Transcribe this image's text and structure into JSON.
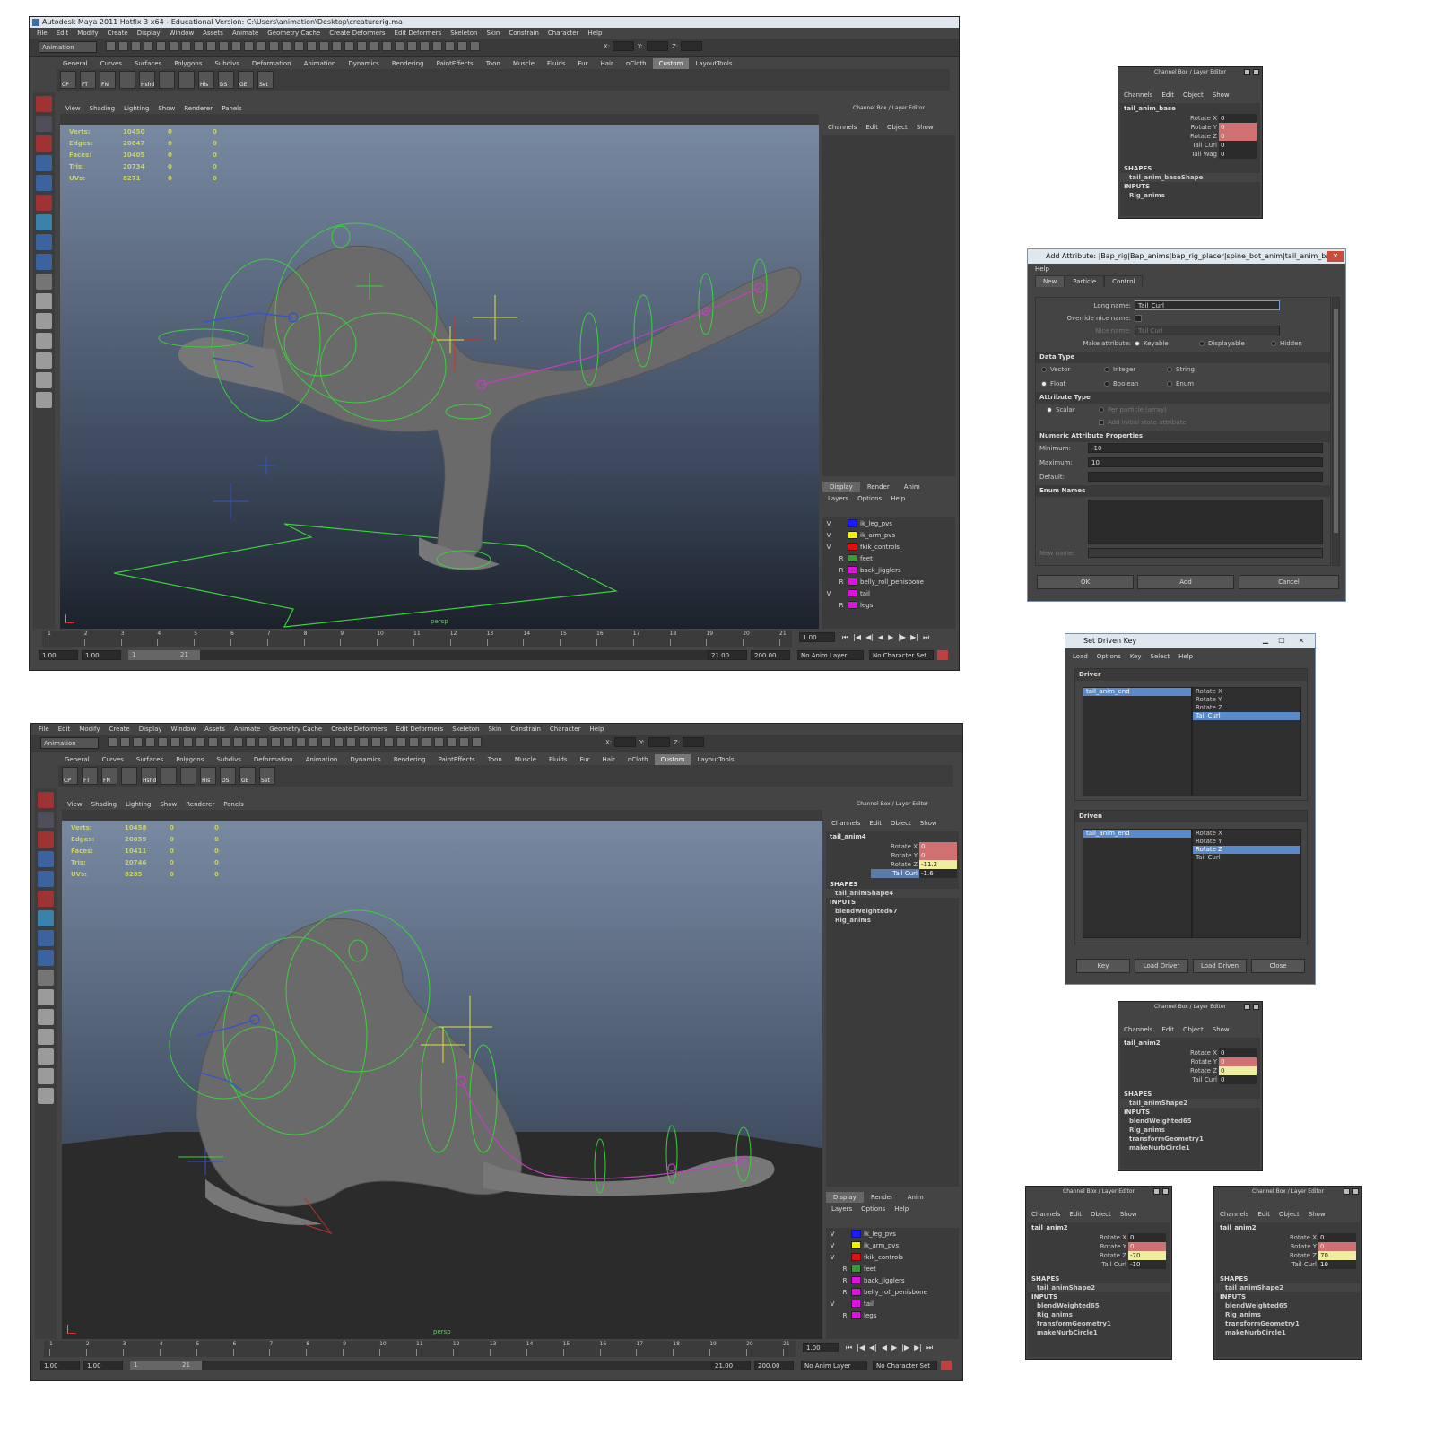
{
  "maya": {
    "title": "Autodesk Maya 2011 Hotfix 3 x64 - Educational Version: C:\\Users\\animation\\Desktop\\creaturerig.ma",
    "menus": [
      "File",
      "Edit",
      "Modify",
      "Create",
      "Display",
      "Window",
      "Assets",
      "Animate",
      "Geometry Cache",
      "Create Deformers",
      "Edit Deformers",
      "Skeleton",
      "Skin",
      "Constrain",
      "Character",
      "Help"
    ],
    "mode": "Animation",
    "field_labels": {
      "x": "X:",
      "y": "Y:",
      "z": "Z:"
    },
    "shelf_tabs": [
      "General",
      "Curves",
      "Surfaces",
      "Polygons",
      "Subdivs",
      "Deformation",
      "Animation",
      "Dynamics",
      "Rendering",
      "PaintEffects",
      "Toon",
      "Muscle",
      "Fluids",
      "Fur",
      "Hair",
      "nCloth",
      "Custom",
      "LayoutTools"
    ],
    "shelf_active": "Custom",
    "shelf_buttons": [
      "CP",
      "FT",
      "FN",
      "",
      "Hshd",
      "",
      "",
      "His",
      "DS",
      "GE",
      "Set"
    ],
    "panel_menus": [
      "View",
      "Shading",
      "Lighting",
      "Show",
      "Renderer",
      "Panels"
    ],
    "hud_labels": [
      "Verts:",
      "Edges:",
      "Faces:",
      "Tris:",
      "UVs:"
    ],
    "camera": "persp",
    "cb_header": "Channel Box / Layer Editor",
    "cb_menus": [
      "Channels",
      "Edit",
      "Object",
      "Show"
    ],
    "layer_tabs": [
      "Display",
      "Render",
      "Anim"
    ],
    "layer_menus": [
      "Layers",
      "Options",
      "Help"
    ],
    "layers": [
      {
        "vis": "V",
        "ref": "",
        "color": "#1a1aff",
        "name": "ik_leg_pvs"
      },
      {
        "vis": "V",
        "ref": "",
        "color": "#f0f000",
        "name": "ik_arm_pvs"
      },
      {
        "vis": "V",
        "ref": "",
        "color": "#e01010",
        "name": "fkik_controls"
      },
      {
        "vis": "",
        "ref": "R",
        "color": "#3a9a3a",
        "name": "feet"
      },
      {
        "vis": "",
        "ref": "R",
        "color": "#e010e0",
        "name": "back_jigglers"
      },
      {
        "vis": "",
        "ref": "R",
        "color": "#e010e0",
        "name": "belly_roll_penisbone"
      },
      {
        "vis": "V",
        "ref": "",
        "color": "#e010e0",
        "name": "tail"
      },
      {
        "vis": "",
        "ref": "R",
        "color": "#e010e0",
        "name": "legs"
      }
    ],
    "ticks": [
      "1",
      "2",
      "3",
      "4",
      "5",
      "6",
      "7",
      "8",
      "9",
      "10",
      "11",
      "12",
      "13",
      "14",
      "15",
      "16",
      "17",
      "18",
      "19",
      "20",
      "21"
    ],
    "current_frame": "1.00",
    "range": {
      "start": "1.00",
      "start2": "1.00",
      "inner_start": "1",
      "inner_end": "21",
      "end": "21.00",
      "end2": "200.00"
    },
    "anim_layer": "No Anim Layer",
    "char_set": "No Character Set",
    "top": {
      "hud": [
        [
          "10450",
          "0",
          "0"
        ],
        [
          "20847",
          "0",
          "0"
        ],
        [
          "10405",
          "0",
          "0"
        ],
        [
          "20734",
          "0",
          "0"
        ],
        [
          "8271",
          "0",
          "0"
        ]
      ]
    },
    "bottom": {
      "hud": [
        [
          "10458",
          "0",
          "0"
        ],
        [
          "20859",
          "0",
          "0"
        ],
        [
          "10411",
          "0",
          "0"
        ],
        [
          "20746",
          "0",
          "0"
        ],
        [
          "8285",
          "0",
          "0"
        ]
      ],
      "cb": {
        "object": "tail_anim4",
        "attrs": [
          {
            "name": "Rotate X",
            "value": "0",
            "style": "red"
          },
          {
            "name": "Rotate Y",
            "value": "0",
            "style": "red"
          },
          {
            "name": "Rotate Z",
            "value": "-11.2",
            "style": "yel"
          },
          {
            "name": "Tail Curl",
            "value": "-1.6",
            "style": "",
            "hl": true
          }
        ],
        "shapes_label": "SHAPES",
        "shape": "tail_animShape4",
        "inputs_label": "INPUTS",
        "inputs": [
          "blendWeighted67",
          "Rig_anims"
        ]
      }
    }
  },
  "cb_base": {
    "object": "tail_anim_base",
    "attrs": [
      {
        "name": "Rotate X",
        "value": "0",
        "style": ""
      },
      {
        "name": "Rotate Y",
        "value": "0",
        "style": "red"
      },
      {
        "name": "Rotate Z",
        "value": "0",
        "style": "red"
      },
      {
        "name": "Tail Curl",
        "value": "0",
        "style": ""
      },
      {
        "name": "Tail Wag",
        "value": "0",
        "style": ""
      }
    ],
    "shapes_label": "SHAPES",
    "shape": "tail_anim_baseShape",
    "inputs_label": "INPUTS",
    "inputs": [
      "Rig_anims"
    ]
  },
  "add_attr": {
    "title": "Add Attribute: |Bap_rig|Bap_anims|bap_rig_placer|spine_bot_anim|tail_anim_base",
    "menu": "Help",
    "tabs": [
      "New",
      "Particle",
      "Control"
    ],
    "long_name_label": "Long name:",
    "long_name": "Tail_Curl",
    "override_label": "Override nice name:",
    "nice_label": "Nice name:",
    "nice_name": "Tail Curl",
    "make_label": "Make attribute:",
    "make_opts": [
      "Keyable",
      "Displayable",
      "Hidden"
    ],
    "data_type_label": "Data Type",
    "data_types": [
      "Vector",
      "Integer",
      "String",
      "Float",
      "Boolean",
      "Enum"
    ],
    "attr_type_label": "Attribute Type",
    "scalar": "Scalar",
    "per_particle": "Per particle (array)",
    "add_initial": "Add initial state attribute",
    "numeric_label": "Numeric Attribute Properties",
    "min_label": "Minimum:",
    "min": "-10",
    "max_label": "Maximum:",
    "max": "10",
    "default_label": "Default:",
    "enum_label": "Enum Names",
    "new_name_label": "New name:",
    "buttons": [
      "OK",
      "Add",
      "Cancel"
    ]
  },
  "sdk": {
    "title": "Set Driven Key",
    "menus": [
      "Load",
      "Options",
      "Key",
      "Select",
      "Help"
    ],
    "driver_label": "Driver",
    "driver_obj": "tail_anim_end",
    "driver_attrs": [
      "Rotate X",
      "Rotate Y",
      "Rotate Z",
      "Tail Curl"
    ],
    "driven_label": "Driven",
    "driven_obj": "tail_anim_end",
    "driven_attrs": [
      "Rotate X",
      "Rotate Y",
      "Rotate Z",
      "Tail Curl"
    ],
    "buttons": [
      "Key",
      "Load Driver",
      "Load Driven",
      "Close"
    ]
  },
  "cb_a": {
    "object": "tail_anim2",
    "attrs": [
      {
        "name": "Rotate X",
        "value": "0",
        "style": ""
      },
      {
        "name": "Rotate Y",
        "value": "0",
        "style": "red"
      },
      {
        "name": "Rotate Z",
        "value": "0",
        "style": "yel"
      },
      {
        "name": "Tail Curl",
        "value": "0",
        "style": ""
      }
    ],
    "shapes_label": "SHAPES",
    "shape": "tail_animShape2",
    "inputs_label": "INPUTS",
    "inputs": [
      "blendWeighted65",
      "Rig_anims",
      "transformGeometry1",
      "makeNurbCircle1"
    ]
  },
  "cb_b": {
    "object": "tail_anim2",
    "attrs": [
      {
        "name": "Rotate X",
        "value": "0",
        "style": ""
      },
      {
        "name": "Rotate Y",
        "value": "0",
        "style": "red"
      },
      {
        "name": "Rotate Z",
        "value": "-70",
        "style": "yel"
      },
      {
        "name": "Tail Curl",
        "value": "-10",
        "style": ""
      }
    ],
    "shapes_label": "SHAPES",
    "shape": "tail_animShape2",
    "inputs_label": "INPUTS",
    "inputs": [
      "blendWeighted65",
      "Rig_anims",
      "transformGeometry1",
      "makeNurbCircle1"
    ]
  },
  "cb_c": {
    "object": "tail_anim2",
    "attrs": [
      {
        "name": "Rotate X",
        "value": "0",
        "style": ""
      },
      {
        "name": "Rotate Y",
        "value": "0",
        "style": "red"
      },
      {
        "name": "Rotate Z",
        "value": "70",
        "style": "yel"
      },
      {
        "name": "Tail Curl",
        "value": "10",
        "style": ""
      }
    ],
    "shapes_label": "SHAPES",
    "shape": "tail_animShape2",
    "inputs_label": "INPUTS",
    "inputs": [
      "blendWeighted65",
      "Rig_anims",
      "transformGeometry1",
      "makeNurbCircle1"
    ]
  }
}
